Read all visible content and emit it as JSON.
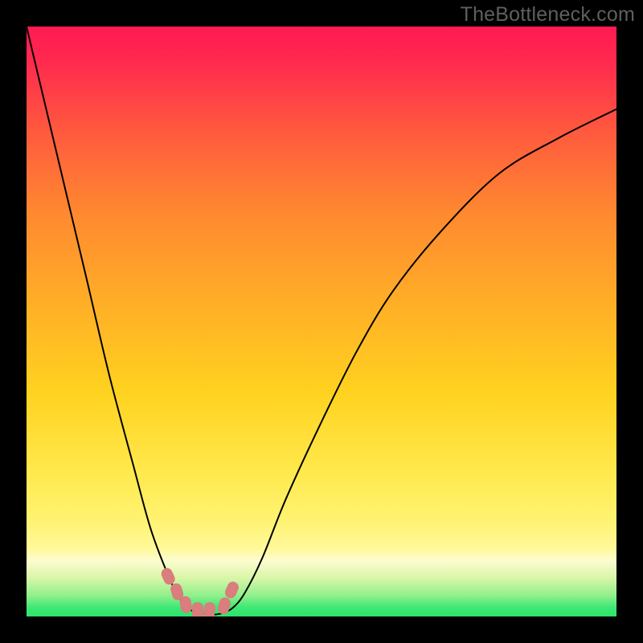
{
  "watermark": "TheBottleneck.com",
  "chart_data": {
    "type": "line",
    "title": "",
    "xlabel": "",
    "ylabel": "",
    "xlim": [
      0,
      100
    ],
    "ylim": [
      0,
      100
    ],
    "background_gradient": {
      "top_color": "#ff1a52",
      "mid_color": "#ffd21f",
      "bottom_narrow_band_color": "#fff99a",
      "base_color": "#2ce56a"
    },
    "series": [
      {
        "name": "bottleneck-curve",
        "x": [
          0,
          5,
          10,
          14,
          18,
          21,
          24,
          26,
          28,
          30,
          31,
          33,
          35,
          37,
          40,
          44,
          50,
          56,
          62,
          70,
          80,
          90,
          100
        ],
        "y": [
          100,
          79,
          58,
          41,
          26,
          15,
          7,
          3,
          1,
          0.5,
          0.3,
          0.5,
          1.5,
          4,
          10,
          20,
          33,
          45,
          55,
          65,
          75,
          81,
          86
        ]
      }
    ],
    "markers": {
      "name": "highlight-points",
      "color": "#d97d7d",
      "radius_approx_pct": 1.6,
      "points_xy": [
        [
          24.0,
          6.8
        ],
        [
          25.5,
          4.2
        ],
        [
          27.0,
          2.0
        ],
        [
          29.0,
          1.0
        ],
        [
          31.0,
          1.0
        ],
        [
          33.5,
          1.8
        ],
        [
          34.8,
          4.5
        ]
      ]
    }
  }
}
